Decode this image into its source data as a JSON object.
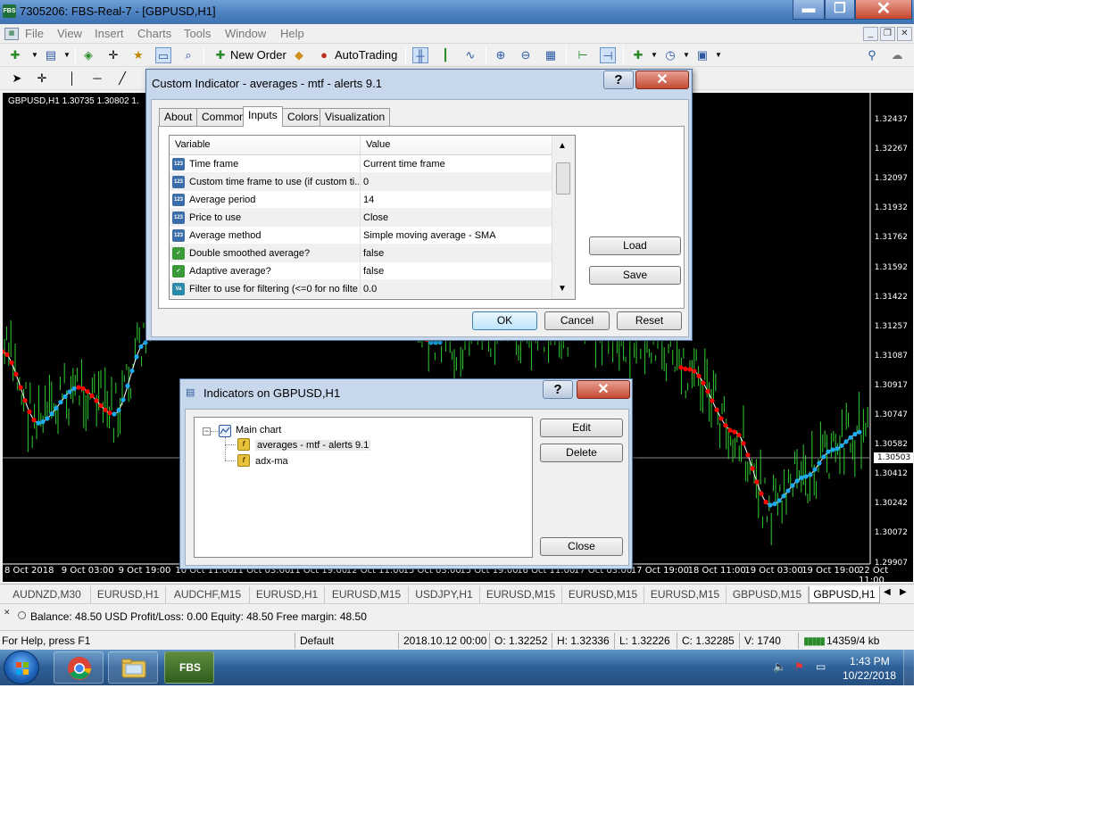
{
  "window": {
    "title": "7305206: FBS-Real-7 - [GBPUSD,H1]",
    "app_icon": "FBS",
    "minimize_glyph": "▬",
    "maximize_glyph": "❐",
    "close_glyph": "✕"
  },
  "menu": {
    "items": [
      "File",
      "View",
      "Insert",
      "Charts",
      "Tools",
      "Window",
      "Help"
    ]
  },
  "toolbar": {
    "new_order": "New Order",
    "autotrading": "AutoTrading"
  },
  "chart": {
    "symbol_label": "GBPUSD,H1  1.30735 1.30802 1.",
    "current_price": "1.30503",
    "price_labels": [
      "1.32437",
      "1.32267",
      "1.32097",
      "1.31932",
      "1.31762",
      "1.31592",
      "1.31422",
      "1.31257",
      "1.31087",
      "1.30917",
      "1.30747",
      "1.30582",
      "1.30412",
      "1.30242",
      "1.30072",
      "1.29907"
    ],
    "time_labels": [
      "8 Oct 2018",
      "9 Oct 03:00",
      "9 Oct 19:00",
      "10 Oct 11:00",
      "11 Oct 03:00",
      "11 Oct 19:00",
      "12 Oct 11:00",
      "15 Oct 03:00",
      "15 Oct 19:00",
      "16 Oct 11:00",
      "17 Oct 03:00",
      "17 Oct 19:00",
      "18 Oct 11:00",
      "19 Oct 03:00",
      "19 Oct 19:00",
      "22 Oct 11:00"
    ],
    "colors": {
      "background": "#000000",
      "candles": "#32cd32",
      "average_down": "#ff0000",
      "average_up": "#1eaaf0",
      "average_line": "#ffffff"
    }
  },
  "chart_tabs": {
    "items": [
      "AUDNZD,M30",
      "EURUSD,H1",
      "AUDCHF,M15",
      "EURUSD,H1",
      "EURUSD,M15",
      "USDJPY,H1",
      "EURUSD,M15",
      "EURUSD,M15",
      "EURUSD,M15",
      "GBPUSD,M15",
      "GBPUSD,H1"
    ],
    "active_index": 10
  },
  "balance": {
    "text": "Balance: 48.50 USD  Profit/Loss: 0.00  Equity: 48.50  Free margin: 48.50"
  },
  "statusbar": {
    "help": "For Help, press F1",
    "profile": "Default",
    "time": "2018.10.12 00:00",
    "open": "O: 1.32252",
    "high": "H: 1.32336",
    "low": "L: 1.32226",
    "close": "C: 1.32285",
    "volume": "V: 1740",
    "traffic": "14359/4 kb"
  },
  "taskbar": {
    "fbs_label": "FBS",
    "clock_time": "1:43 PM",
    "clock_date": "10/22/2018"
  },
  "indicator_dialog": {
    "title": "Custom Indicator - averages - mtf - alerts  9.1",
    "help_glyph": "?",
    "close_glyph": "✕",
    "tabs": [
      "About",
      "Common",
      "Inputs",
      "Colors",
      "Visualization"
    ],
    "active_tab": 2,
    "grid": {
      "header_variable": "Variable",
      "header_value": "Value",
      "rows": [
        {
          "icon": "123",
          "variable": "Time frame",
          "value": "Current time frame"
        },
        {
          "icon": "123",
          "variable": "Custom time frame to use (if custom ti...",
          "value": "0"
        },
        {
          "icon": "123",
          "variable": "Average period",
          "value": "14"
        },
        {
          "icon": "123",
          "variable": "Price to use",
          "value": "Close"
        },
        {
          "icon": "123",
          "variable": "Average method",
          "value": "Simple moving average - SMA"
        },
        {
          "icon": "bool",
          "variable": "Double smoothed average?",
          "value": "false"
        },
        {
          "icon": "bool",
          "variable": "Adaptive average?",
          "value": "false"
        },
        {
          "icon": "Va",
          "variable": "Filter to use for filtering (<=0 for no filte...",
          "value": "0.0"
        }
      ]
    },
    "buttons": {
      "load": "Load",
      "save": "Save",
      "ok": "OK",
      "cancel": "Cancel",
      "reset": "Reset"
    }
  },
  "list_dialog": {
    "title": "Indicators on GBPUSD,H1",
    "help_glyph": "?",
    "close_glyph": "✕",
    "tree": {
      "root": "Main chart",
      "children": [
        "averages - mtf - alerts  9.1",
        "adx-ma"
      ]
    },
    "buttons": {
      "edit": "Edit",
      "delete": "Delete",
      "close": "Close"
    }
  }
}
